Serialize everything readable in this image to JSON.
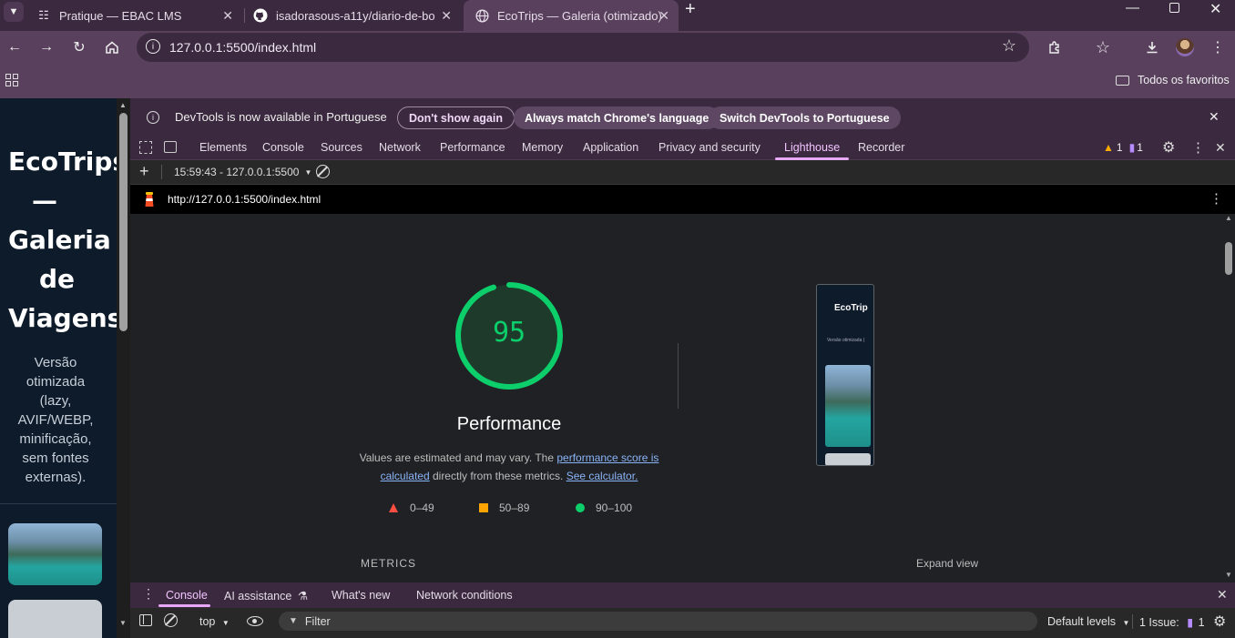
{
  "tabs": [
    {
      "title": "Pratique — EBAC LMS",
      "icon": "ebac-icon",
      "active": false
    },
    {
      "title": "isadorasous-a11y/diario-de-bo",
      "icon": "github-icon",
      "active": false
    },
    {
      "title": "EcoTrips — Galeria (otimizado)",
      "icon": "globe-icon",
      "active": true
    }
  ],
  "toolbar": {
    "url": "127.0.0.1:5500/index.html"
  },
  "bookmarks": {
    "folder_label": "Todos os favoritos"
  },
  "page": {
    "title_lines": [
      "EcoTrips",
      "—",
      "Galeria",
      "de",
      "Viagens"
    ],
    "subtitle_lines": [
      "Versão",
      "otimizada",
      "(lazy,",
      "AVIF/WEBP,",
      "minificação,",
      "sem fontes",
      "externas)."
    ]
  },
  "infobar": {
    "message": "DevTools is now available in Portuguese",
    "dont_show": "Don't show again",
    "always_match": "Always match Chrome's language",
    "switch": "Switch DevTools to Portuguese"
  },
  "devtools_tabs": [
    "Elements",
    "Console",
    "Sources",
    "Network",
    "Performance",
    "Memory",
    "Application",
    "Privacy and security",
    "Lighthouse",
    "Recorder"
  ],
  "devtools_badges": {
    "warnings": "1",
    "issues": "1"
  },
  "lighthouse": {
    "report_selector": "15:59:43 - 127.0.0.1:5500",
    "report_url": "http://127.0.0.1:5500/index.html",
    "score": "95",
    "score_fraction": 0.95,
    "score_color": "#0cce6b",
    "category": "Performance",
    "note_prefix": "Values are estimated and may vary. The ",
    "note_link1": "performance score is calculated",
    "note_middle": " directly from these metrics. ",
    "note_link2": "See calculator.",
    "legend": [
      {
        "range": "0–49",
        "color": "#ff4e42",
        "shape": "triangle"
      },
      {
        "range": "50–89",
        "color": "#ffa400",
        "shape": "square"
      },
      {
        "range": "90–100",
        "color": "#0cce6b",
        "shape": "circle"
      }
    ],
    "metrics_heading": "METRICS",
    "expand_view": "Expand view",
    "preview_title": "EcoTrip",
    "preview_sub": "Versão otimizada ("
  },
  "drawer": {
    "tabs": [
      "Console",
      "AI assistance",
      "What's new",
      "Network conditions"
    ],
    "context": "top",
    "filter_placeholder": "Filter",
    "levels": "Default levels",
    "issues": "1 Issue:",
    "issues_count": "1"
  }
}
